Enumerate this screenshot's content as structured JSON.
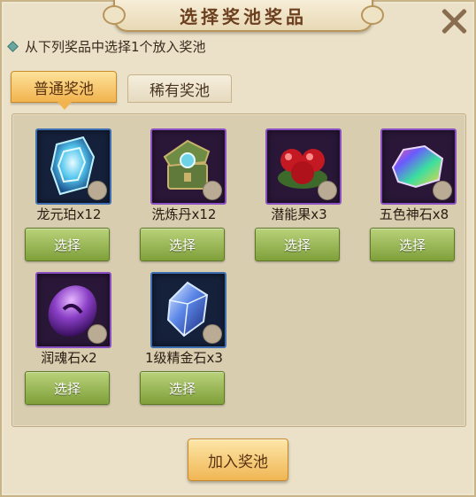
{
  "title": "选择奖池奖品",
  "instruction": "从下列奖品中选择1个放入奖池",
  "tabs": [
    {
      "label": "普通奖池",
      "active": true
    },
    {
      "label": "稀有奖池",
      "active": false
    }
  ],
  "items": [
    {
      "name": "龙元珀x12",
      "icon": "blue-crystal-icon",
      "select_label": "选择"
    },
    {
      "name": "洗炼丹x12",
      "icon": "treasure-chest-icon",
      "select_label": "选择"
    },
    {
      "name": "潜能果x3",
      "icon": "red-berries-icon",
      "select_label": "选择"
    },
    {
      "name": "五色神石x8",
      "icon": "rainbow-stone-icon",
      "select_label": "选择"
    },
    {
      "name": "润魂石x2",
      "icon": "purple-stone-icon",
      "select_label": "选择"
    },
    {
      "name": "1级精金石x3",
      "icon": "blue-gem-icon",
      "select_label": "选择"
    }
  ],
  "add_button_label": "加入奖池"
}
